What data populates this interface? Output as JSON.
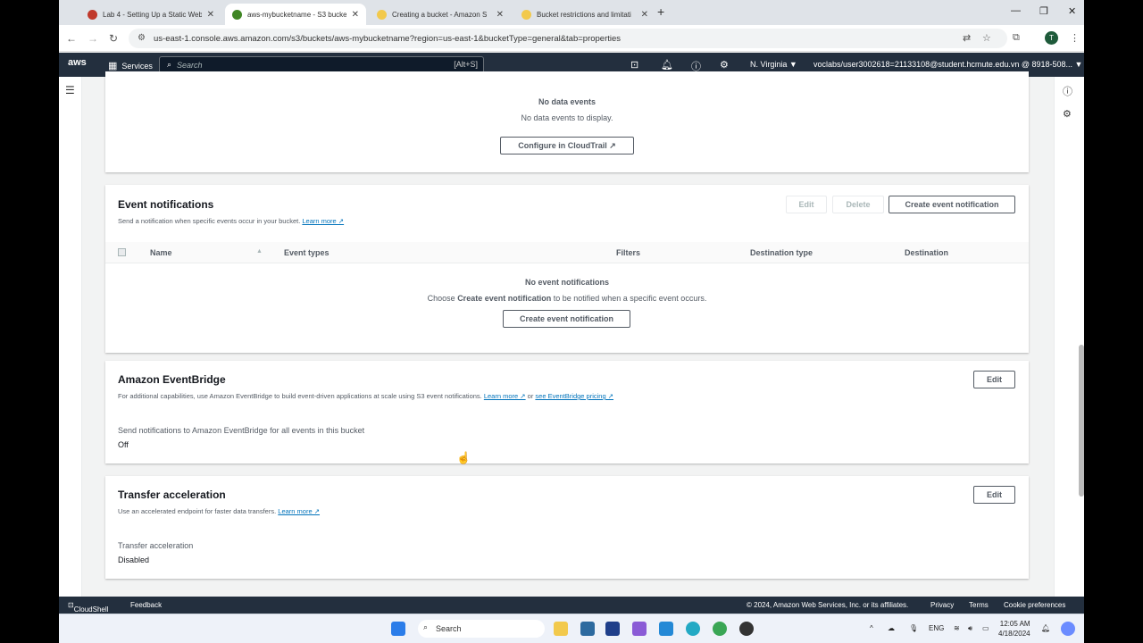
{
  "browser": {
    "tabs": [
      {
        "title": "Lab 4 - Setting Up a Static Web",
        "favicon_color": "#c0392b"
      },
      {
        "title": "aws-mybucketname - S3 bucke",
        "favicon_color": "#3f8624",
        "active": true
      },
      {
        "title": "Creating a bucket - Amazon S",
        "favicon_color": "#f2c94c"
      },
      {
        "title": "Bucket restrictions and limitati",
        "favicon_color": "#f2c94c"
      }
    ],
    "new_tab": "+",
    "url": "us-east-1.console.aws.amazon.com/s3/buckets/aws-mybucketname?region=us-east-1&bucketType=general&tab=properties",
    "profile_initial": "T"
  },
  "aws_header": {
    "logo": "aws",
    "services_label": "Services",
    "search_placeholder": "Search",
    "search_shortcut": "[Alt+S]",
    "region": "N. Virginia ▼",
    "account": "voclabs/user3002618=21133108@student.hcmute.edu.vn @ 8918-508... ▼"
  },
  "data_events": {
    "empty_title": "No data events",
    "empty_desc": "No data events to display.",
    "configure_button": "Configure in CloudTrail ↗"
  },
  "event_notifications": {
    "title": "Event notifications",
    "desc": "Send a notification when specific events occur in your bucket.",
    "learn_more": "Learn more ↗",
    "edit_button": "Edit",
    "delete_button": "Delete",
    "create_button": "Create event notification",
    "columns": [
      "Name",
      "Event types",
      "Filters",
      "Destination type",
      "Destination"
    ],
    "sort_indicator": "▲",
    "empty_title": "No event notifications",
    "empty_desc_prefix": "Choose ",
    "empty_desc_bold": "Create event notification",
    "empty_desc_suffix": " to be notified when a specific event occurs.",
    "empty_create_button": "Create event notification"
  },
  "eventbridge": {
    "title": "Amazon EventBridge",
    "desc": "For additional capabilities, use Amazon EventBridge to build event-driven applications at scale using S3 event notifications.",
    "learn_more": "Learn more ↗",
    "or": " or ",
    "pricing_link": "see EventBridge pricing ↗",
    "edit_button": "Edit",
    "setting_label": "Send notifications to Amazon EventBridge for all events in this bucket",
    "setting_value": "Off"
  },
  "transfer_acceleration": {
    "title": "Transfer acceleration",
    "desc": "Use an accelerated endpoint for faster data transfers.",
    "learn_more": "Learn more ↗",
    "edit_button": "Edit",
    "setting_label": "Transfer acceleration",
    "setting_value": "Disabled"
  },
  "console_footer": {
    "cloudshell": "CloudShell",
    "feedback": "Feedback",
    "copyright": "© 2024, Amazon Web Services, Inc. or its affiliates.",
    "privacy": "Privacy",
    "terms": "Terms",
    "cookies": "Cookie preferences"
  },
  "taskbar": {
    "search_label": "Search",
    "language": "ENG",
    "time": "12:05 AM",
    "date": "4/18/2024"
  }
}
